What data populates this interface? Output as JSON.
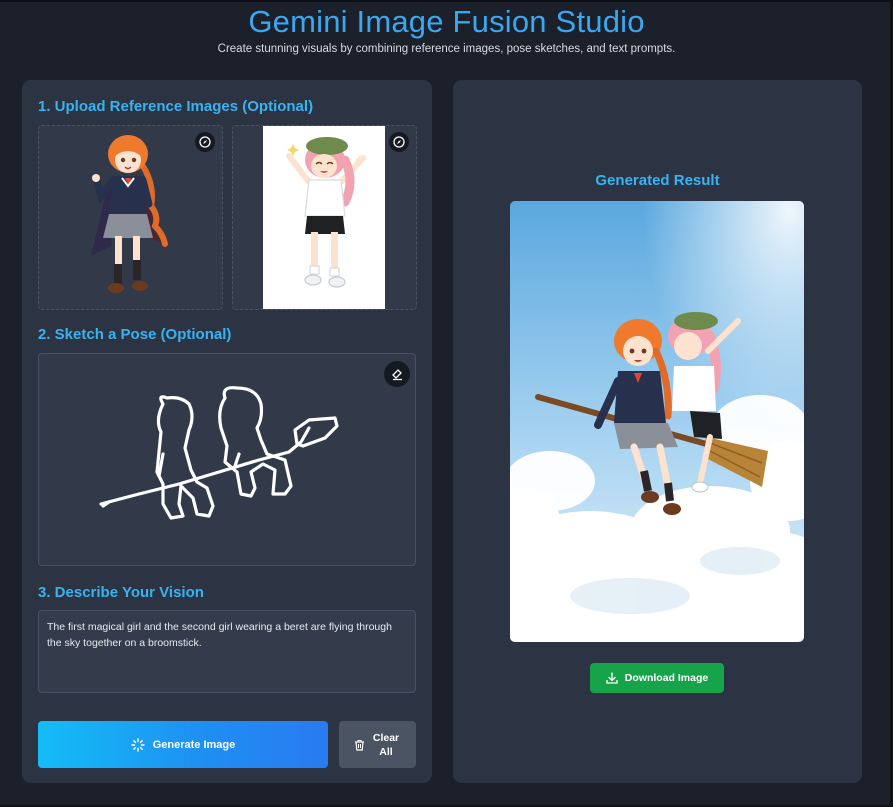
{
  "header": {
    "title": "Gemini Image Fusion Studio",
    "subtitle": "Create stunning visuals by combining reference images, pose sketches, and text prompts."
  },
  "upload_section": {
    "title": "1. Upload Reference Images (Optional)",
    "slots": [
      {
        "action_icon": "compass-icon"
      },
      {
        "action_icon": "compass-icon"
      }
    ]
  },
  "sketch_section": {
    "title": "2. Sketch a Pose (Optional)",
    "tool_icon": "eraser-icon"
  },
  "prompt_section": {
    "title": "3. Describe Your Vision",
    "value": "The first magical girl and the second girl wearing a beret are flying through the sky together on a broomstick."
  },
  "actions": {
    "generate_label": "Generate Image",
    "generate_icon": "sparkle-loader-icon",
    "clear_label": "Clear All",
    "clear_icon": "trash-icon"
  },
  "result": {
    "title": "Generated Result",
    "download_label": "Download Image",
    "download_icon": "download-icon"
  },
  "colors": {
    "accent": "#38b3f2",
    "background": "#1b202b",
    "panel": "#2c3343",
    "generate_start": "#14bdf7",
    "generate_end": "#2a7af0",
    "download": "#17a34a"
  }
}
